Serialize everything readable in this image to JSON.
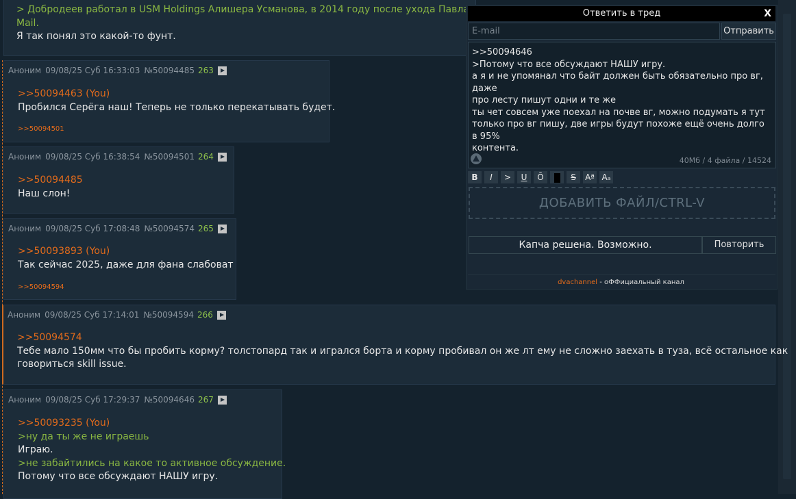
{
  "top_post": {
    "quote_line1": "> Добродеев работал в USM Holdings Алишера Усманова, в 2014 году после ухода Павла Дуро",
    "quote_line2": "Mail.",
    "text": "Я так понял это какой-то фунт."
  },
  "posts": [
    {
      "author": "Аноним",
      "date": "09/08/25 Суб 16:33:03",
      "id": "№50094485",
      "num": "263",
      "lines": [
        {
          "type": "link",
          "text": ">>50094463 (You)"
        },
        {
          "type": "text",
          "text": "Пробился Серёга наш! Теперь не только перекатывать будет."
        }
      ],
      "backlink": ">>50094501"
    },
    {
      "author": "Аноним",
      "date": "09/08/25 Суб 16:38:54",
      "id": "№50094501",
      "num": "264",
      "lines": [
        {
          "type": "link",
          "text": ">>50094485"
        },
        {
          "type": "text",
          "text": "Наш слон!"
        }
      ]
    },
    {
      "author": "Аноним",
      "date": "09/08/25 Суб 17:08:48",
      "id": "№50094574",
      "num": "265",
      "lines": [
        {
          "type": "link",
          "text": ">>50093893 (You)"
        },
        {
          "type": "text",
          "text": "Так сейчас 2025, даже для фана слабоват"
        }
      ],
      "backlink": ">>50094594"
    },
    {
      "author": "Аноним",
      "date": "09/08/25 Суб 17:14:01",
      "id": "№50094594",
      "num": "266",
      "lines": [
        {
          "type": "link",
          "text": ">>50094574"
        },
        {
          "type": "text",
          "text": "Тебе мало 150мм что бы пробить корму? толстопард так и игрался борта и корму пробивал он же лт ему не сложно заехать в туза, всё остальное как"
        },
        {
          "type": "text",
          "text": "говориться skill issue."
        }
      ]
    },
    {
      "author": "Аноним",
      "date": "09/08/25 Суб 17:29:37",
      "id": "№50094646",
      "num": "267",
      "lines": [
        {
          "type": "link",
          "text": ">>50093235 (You)"
        },
        {
          "type": "quote",
          "text": ">ну да ты же не играешь"
        },
        {
          "type": "text",
          "text": "Играю."
        },
        {
          "type": "quote",
          "text": ">не забайтились на какое то активное обсуждение."
        },
        {
          "type": "text",
          "text": "Потому что все обсуждают НАШУ игру."
        }
      ]
    }
  ],
  "form": {
    "title": "Ответить в тред",
    "close": "X",
    "email_placeholder": "E-mail",
    "send": "Отправить",
    "message": ">>50094646\n>Потому что все обсуждают НАШУ игру.\nа я и не упомянал что байт должен быть обязательно про вг, даже\nпро лесту пишут одни и те же\nты чет совсем уже поехал на почве вг, можно подумать я тут\nтолько про вг пишу, две игры будут похоже ещё очень долго в 95%\nконтента.",
    "counter": "40Мб / 4 файла / 14524",
    "toolbar": [
      "B",
      "I",
      ">",
      "U",
      "Ō",
      "",
      "S",
      "Aª",
      "Aₐ"
    ],
    "dropzone": "ДОБАВИТЬ ФАЙЛ/CTRL-V",
    "captcha": "Капча решена. Возможно.",
    "retry": "Повторить",
    "channel": "dvachannel",
    "channel_suffix": " - оФФициальный канал"
  },
  "colors": {
    "link": "#e36b1b",
    "quote": "#8ab742",
    "num": "#8ec14b",
    "background": "#14222d",
    "post": "#1c2c39"
  }
}
